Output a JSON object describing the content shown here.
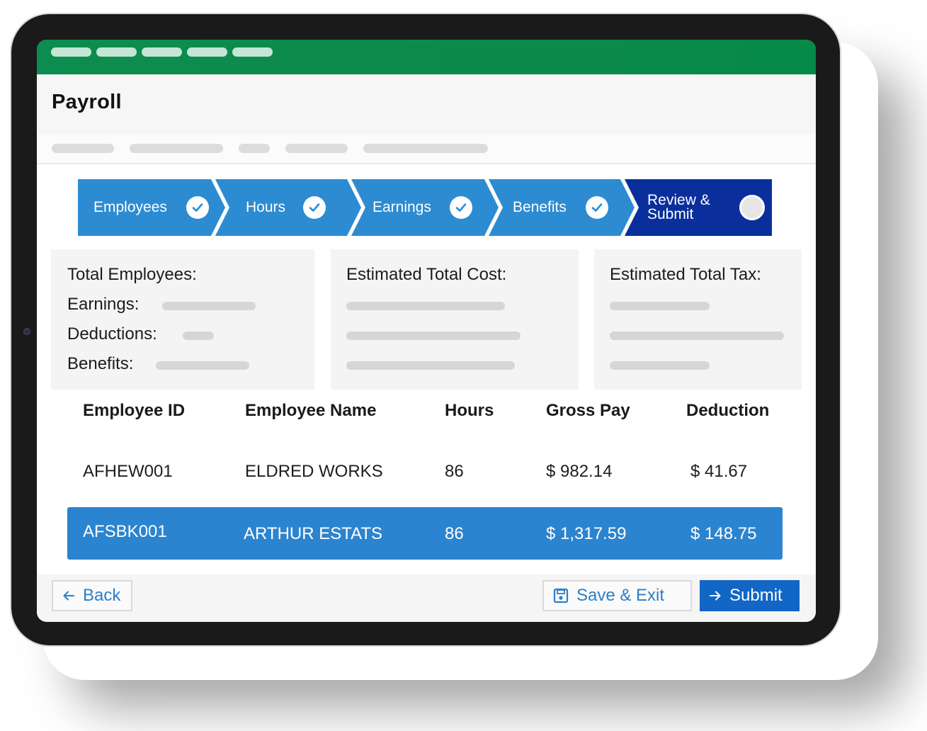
{
  "app": {
    "title": "Payroll",
    "brand_color": "#0d8c4f",
    "accent_color": "#2b84cf",
    "active_step_color": "#0a2f9c"
  },
  "stepper": {
    "steps": [
      {
        "label": "Employees",
        "status": "complete",
        "icon": "check-icon"
      },
      {
        "label": "Hours",
        "status": "complete",
        "icon": "check-icon"
      },
      {
        "label": "Earnings",
        "status": "complete",
        "icon": "check-icon"
      },
      {
        "label": "Benefits",
        "status": "complete",
        "icon": "check-icon"
      },
      {
        "label_line1": "Review &",
        "label_line2": "Submit",
        "status": "current",
        "icon": "radio-dot-icon"
      }
    ]
  },
  "summary": {
    "employees_card": {
      "total_label": "Total Employees:",
      "earnings_label": "Earnings:",
      "deductions_label": "Deductions:",
      "benefits_label": "Benefits:"
    },
    "cost_card": {
      "label": "Estimated Total Cost:"
    },
    "tax_card": {
      "label": "Estimated Total Tax:"
    }
  },
  "table": {
    "columns": [
      "Employee ID",
      "Employee Name",
      "Hours",
      "Gross Pay",
      "Deduction"
    ],
    "rows": [
      {
        "id": "AFHEW001",
        "name": "ELDRED WORKS",
        "hours": "86",
        "gross_pay": "$ 982.14",
        "deduction": "$ 41.67",
        "selected": false
      },
      {
        "id": "AFSBK001",
        "name": "ARTHUR ESTATS",
        "hours": "86",
        "gross_pay": "$ 1,317.59",
        "deduction": "$ 148.75",
        "selected": true
      }
    ]
  },
  "footer": {
    "back_label": "Back",
    "save_label": "Save & Exit",
    "submit_label": "Submit"
  }
}
